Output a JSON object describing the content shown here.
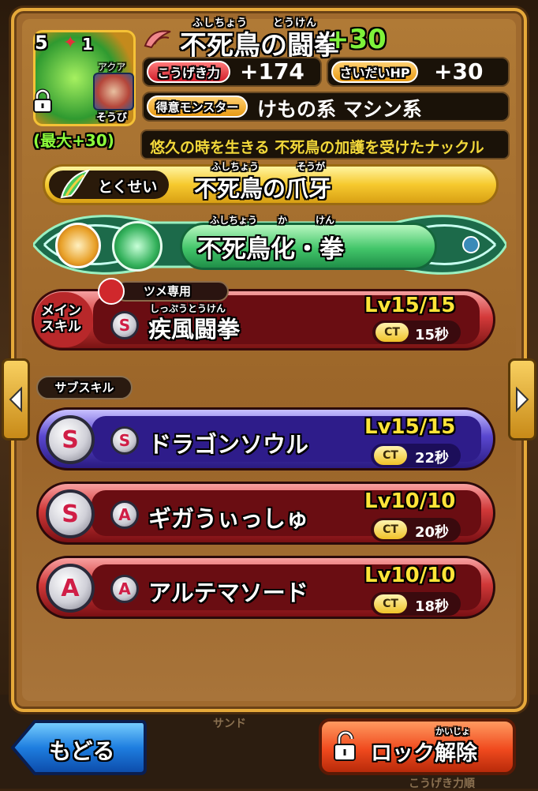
{
  "item": {
    "level": "5",
    "stars": "1",
    "attribute": "アクア",
    "equip_label": "そうび",
    "max_bonus": "(最大+30)",
    "title_ruby_1": "ふしちょう",
    "title_ruby_2": "とうけん",
    "title": "不死鳥の闘拳",
    "plus": "+30"
  },
  "stats": {
    "attack_label": "こうげき力",
    "attack_value": "+174",
    "hp_label": "さいだいHP",
    "hp_value": "+30",
    "monster_label": "得意モンスター",
    "monster_value": "けもの系 マシン系",
    "description": "悠久の時を生きる 不死鳥の加護を受けたナックル"
  },
  "trait": {
    "tag": "とくせい",
    "ruby_1": "ふしちょう",
    "ruby_2": "そうが",
    "name": "不死鳥の爪牙"
  },
  "transform": {
    "ruby_1": "ふしちょう",
    "ruby_2": "か",
    "ruby_3": "けん",
    "name": "不死鳥化・拳"
  },
  "main_skill": {
    "label_line1": "メイン",
    "label_line2": "スキル",
    "tag": "ツメ専用",
    "rank": "S",
    "ruby": "しっぷうとうけん",
    "name": "疾風闘拳",
    "level": "Lv15/15",
    "ct_label": "CT",
    "ct_value": "15秒"
  },
  "sub_skills_label": "サブスキル",
  "sub_skills": [
    {
      "slot_rank": "S",
      "rank": "S",
      "name": "ドラゴンソウル",
      "level": "Lv15/15",
      "ct_label": "CT",
      "ct_value": "22秒"
    },
    {
      "slot_rank": "S",
      "rank": "A",
      "name": "ギガうぃっしゅ",
      "level": "Lv10/10",
      "ct_label": "CT",
      "ct_value": "20秒"
    },
    {
      "slot_rank": "A",
      "rank": "A",
      "name": "アルテマソード",
      "level": "Lv10/10",
      "ct_label": "CT",
      "ct_value": "18秒"
    }
  ],
  "footer": {
    "back_label": "もどる",
    "unlock_label": "ロック解除",
    "unlock_ruby": "かいじょ",
    "bg_text_1": "サンド",
    "bg_text_2": "こうげき力順"
  },
  "colors": {
    "accent_gold": "#f6c92e",
    "stat_red": "#e02a32",
    "plus_green": "#7ef23a",
    "sub_purple": "#4a3ab0",
    "sub_red": "#8a1418"
  }
}
